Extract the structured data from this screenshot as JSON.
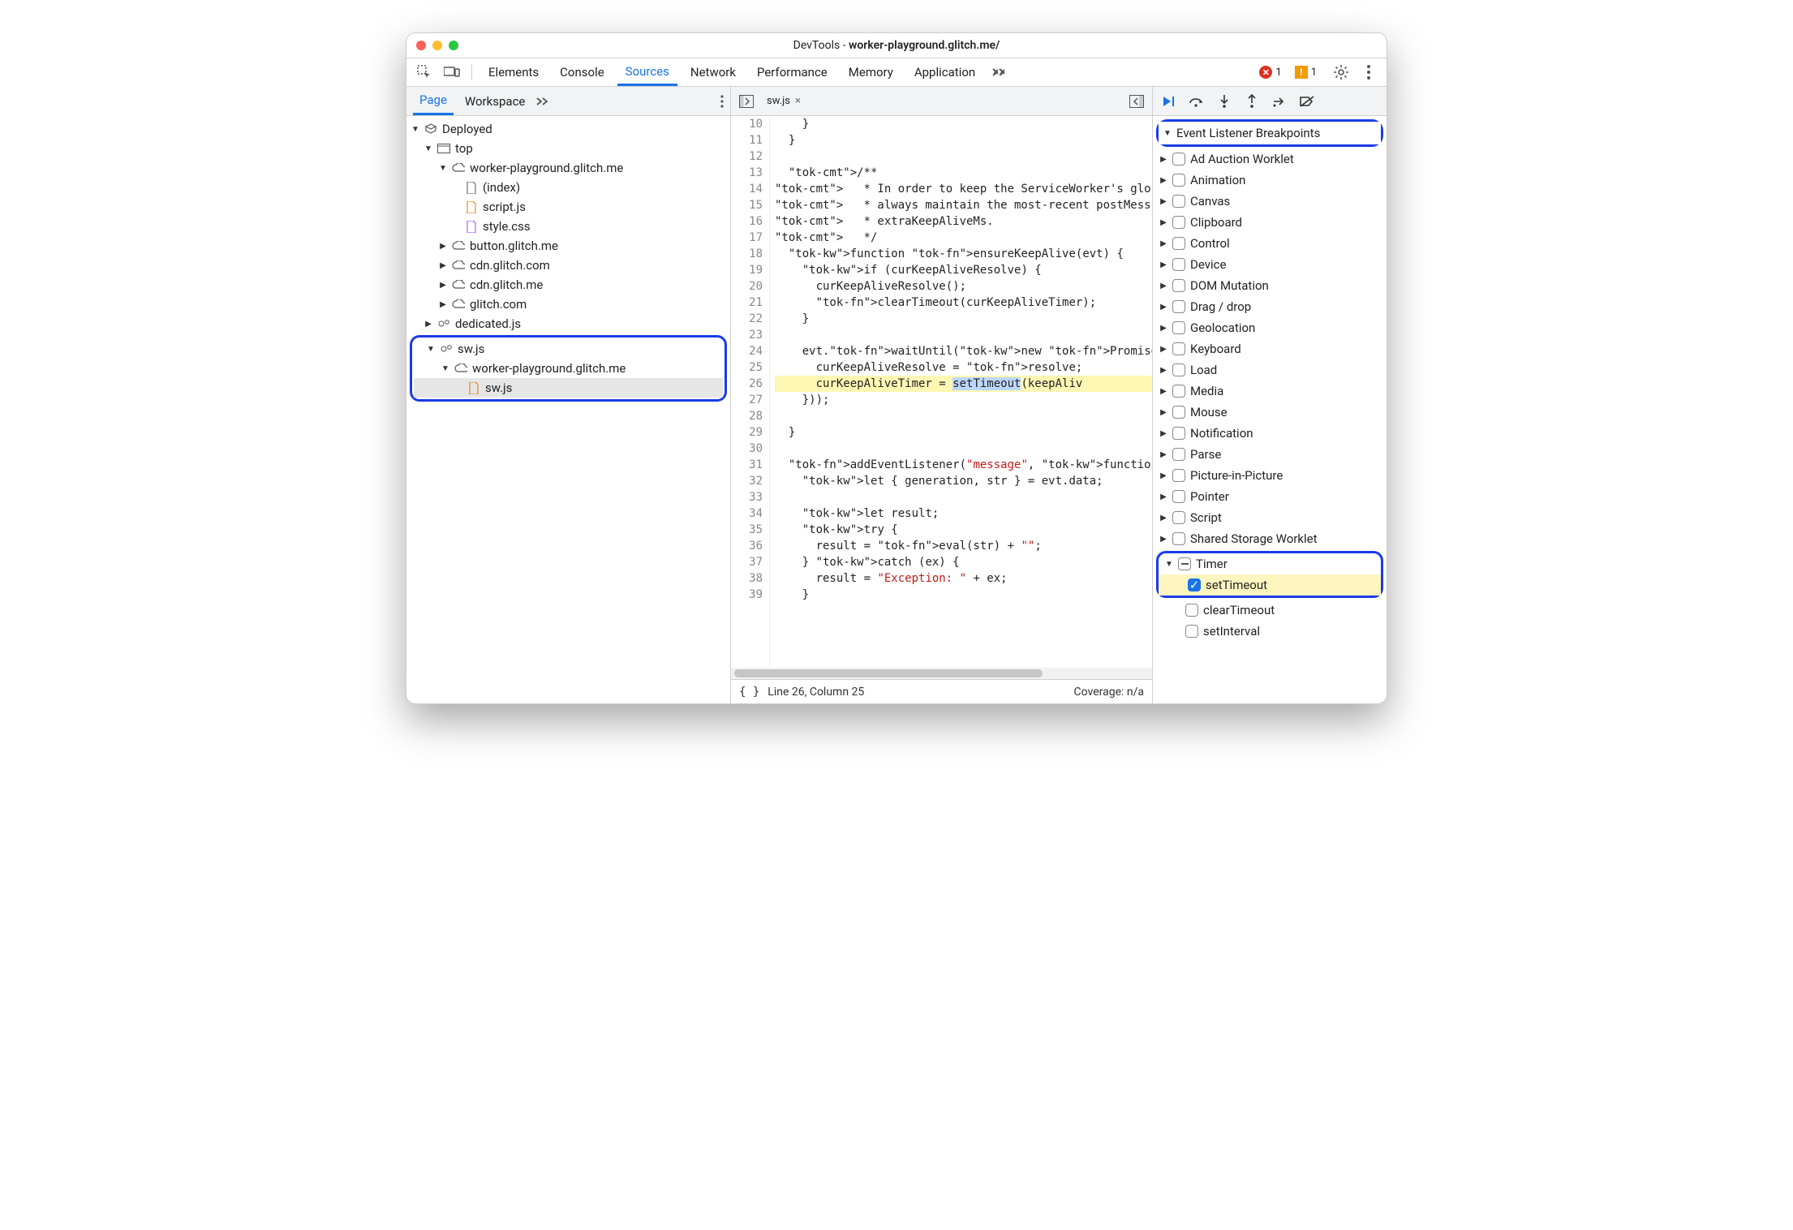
{
  "window": {
    "title_prefix": "DevTools - ",
    "title_host": "worker-playground.glitch.me/"
  },
  "tabs": {
    "items": [
      "Elements",
      "Console",
      "Sources",
      "Network",
      "Performance",
      "Memory",
      "Application"
    ],
    "active": "Sources",
    "errors_count": "1",
    "warns_count": "1"
  },
  "left": {
    "subtabs": [
      "Page",
      "Workspace"
    ],
    "active": "Page",
    "tree": {
      "root": "Deployed",
      "top": "top",
      "origin1": "worker-playground.glitch.me",
      "files1": [
        "(index)",
        "script.js",
        "style.css"
      ],
      "origins_collapsed": [
        "button.glitch.me",
        "cdn.glitch.com",
        "cdn.glitch.me",
        "glitch.com"
      ],
      "dedicated": "dedicated.js",
      "sw_root": "sw.js",
      "sw_origin": "worker-playground.glitch.me",
      "sw_file": "sw.js"
    }
  },
  "editor": {
    "open_file": "sw.js",
    "first_line_no": 10,
    "lines": [
      "    }",
      "  }",
      "",
      "  /**",
      "   * In order to keep the ServiceWorker's glo",
      "   * always maintain the most-recent postMess",
      "   * extraKeepAliveMs.",
      "   */",
      "  function ensureKeepAlive(evt) {",
      "    if (curKeepAliveResolve) {",
      "      curKeepAliveResolve();",
      "      clearTimeout(curKeepAliveTimer);",
      "    }",
      "",
      "    evt.waitUntil(new Promise((resolve) => {",
      "      curKeepAliveResolve = resolve;",
      "      curKeepAliveTimer = setTimeout(keepAliv",
      "    }));",
      "",
      "  }",
      "",
      "  addEventListener(\"message\", function(evt) {",
      "    let { generation, str } = evt.data;",
      "",
      "    let result;",
      "    try {",
      "      result = eval(str) + \"\";",
      "    } catch (ex) {",
      "      result = \"Exception: \" + ex;",
      "    }"
    ],
    "highlight_line": 26,
    "status": {
      "position": "Line 26, Column 25",
      "coverage": "Coverage: n/a"
    }
  },
  "right": {
    "section_title": "Event Listener Breakpoints",
    "categories": [
      "Ad Auction Worklet",
      "Animation",
      "Canvas",
      "Clipboard",
      "Control",
      "Device",
      "DOM Mutation",
      "Drag / drop",
      "Geolocation",
      "Keyboard",
      "Load",
      "Media",
      "Mouse",
      "Notification",
      "Parse",
      "Picture-in-Picture",
      "Pointer",
      "Script",
      "Shared Storage Worklet"
    ],
    "timer": {
      "label": "Timer",
      "children": [
        {
          "label": "setTimeout",
          "checked": true
        },
        {
          "label": "clearTimeout",
          "checked": false
        },
        {
          "label": "setInterval",
          "checked": false
        }
      ]
    }
  }
}
